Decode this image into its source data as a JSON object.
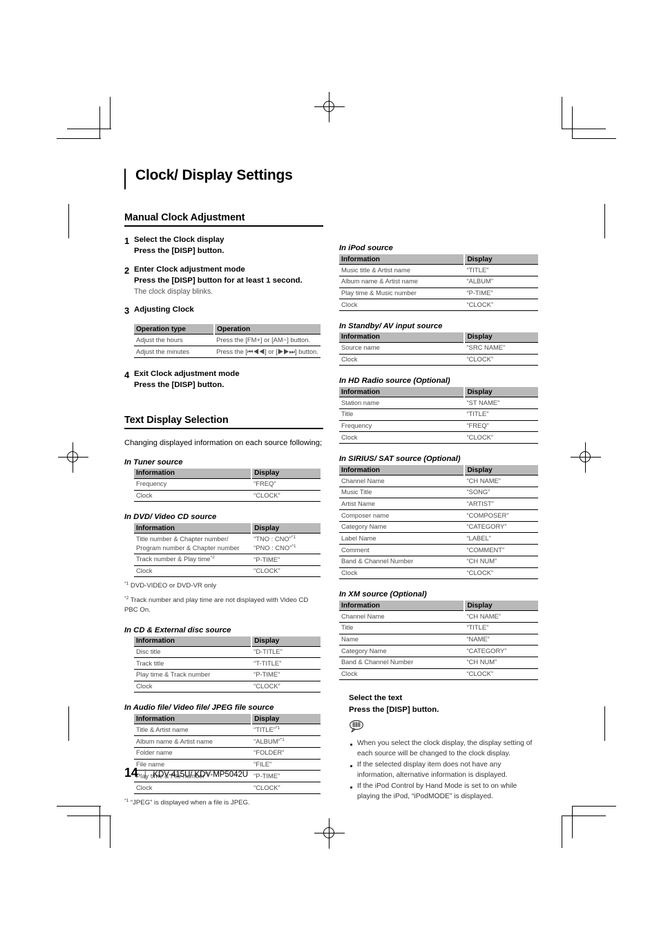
{
  "document": {
    "chapter_title": "Clock/ Display Settings",
    "footer": {
      "page_number": "14",
      "divider": "|",
      "model": "KDV-415U/ KDV-MP5042U"
    }
  },
  "manual_clock": {
    "heading": "Manual Clock Adjustment",
    "steps": [
      {
        "num": "1",
        "title": "Select the Clock display",
        "sub": "Press the [DISP] button.",
        "note": ""
      },
      {
        "num": "2",
        "title": "Enter Clock adjustment mode",
        "sub": "Press the [DISP] button for at least 1 second.",
        "note": "The clock display blinks."
      },
      {
        "num": "3",
        "title": "Adjusting Clock",
        "sub": "",
        "note": ""
      },
      {
        "num": "4",
        "title": "Exit Clock adjustment mode",
        "sub": "Press the [DISP] button.",
        "note": ""
      }
    ],
    "operation_table": {
      "headers": [
        "Operation type",
        "Operation"
      ],
      "rows": [
        [
          "Adjust the hours",
          "Press the [FM+] or [AM−] button."
        ],
        [
          "Adjust the minutes",
          "Press the [⏮◀◀] or [▶▶⏭] button."
        ]
      ]
    }
  },
  "text_display": {
    "heading": "Text Display Selection",
    "intro": "Changing displayed information on each source following;",
    "common_headers": [
      "Information",
      "Display"
    ],
    "tables": [
      {
        "caption": "In Tuner source",
        "rows": [
          [
            "Frequency",
            "“FREQ”"
          ],
          [
            "Clock",
            "“CLOCK”"
          ]
        ]
      },
      {
        "caption": "In DVD/ Video CD source",
        "rows": [
          [
            "Title number & Chapter number/",
            "“TNO : CNO”*1"
          ],
          [
            "Program number & Chapter number",
            "“PNO : CNO”*1"
          ],
          [
            "Track number & Play time*2",
            "“P-TIME”"
          ],
          [
            "Clock",
            "“CLOCK”"
          ]
        ],
        "footnotes": [
          "*1 DVD-VIDEO or DVD-VR only",
          "*2 Track number and play time are not displayed with Video CD PBC On."
        ]
      },
      {
        "caption": "In CD & External disc source",
        "rows": [
          [
            "Disc title",
            "“D-TITLE”"
          ],
          [
            "Track title",
            "“T-TITLE”"
          ],
          [
            "Play time & Track number",
            "“P-TIME”"
          ],
          [
            "Clock",
            "“CLOCK”"
          ]
        ]
      },
      {
        "caption": "In Audio file/ Video file/ JPEG file source",
        "rows": [
          [
            "Title & Artist name",
            "“TITLE”*1"
          ],
          [
            "Album name & Artist name",
            "“ALBUM”*1"
          ],
          [
            "Folder name",
            "“FOLDER”"
          ],
          [
            "File name",
            "“FILE”"
          ],
          [
            "Play time & File number*1",
            "“P-TIME”"
          ],
          [
            "Clock",
            "“CLOCK”"
          ]
        ],
        "footnotes": [
          "*1 “JPEG” is displayed when a file is JPEG."
        ]
      },
      {
        "caption": "In iPod source",
        "rows": [
          [
            "Music title & Artist name",
            "“TITLE”"
          ],
          [
            "Album name & Artist name",
            "“ALBUM”"
          ],
          [
            "Play time & Music number",
            "“P-TIME”"
          ],
          [
            "Clock",
            "“CLOCK”"
          ]
        ]
      },
      {
        "caption": "In Standby/ AV input source",
        "rows": [
          [
            "Source name",
            "“SRC NAME”"
          ],
          [
            "Clock",
            "“CLOCK”"
          ]
        ]
      },
      {
        "caption": "In HD Radio source (Optional)",
        "rows": [
          [
            "Station name",
            "“ST NAME”"
          ],
          [
            "Title",
            "“TITLE”"
          ],
          [
            "Frequency",
            "“FREQ”"
          ],
          [
            "Clock",
            "“CLOCK”"
          ]
        ]
      },
      {
        "caption": "In SIRIUS/ SAT source (Optional)",
        "rows": [
          [
            "Channel Name",
            "“CH NAME”"
          ],
          [
            "Music Title",
            "“SONG”"
          ],
          [
            "Artist Name",
            "“ARTIST”"
          ],
          [
            "Composer name",
            "“COMPOSER”"
          ],
          [
            "Category Name",
            "“CATEGORY”"
          ],
          [
            "Label Name",
            "“LABEL”"
          ],
          [
            "Comment",
            "“COMMENT”"
          ],
          [
            "Band & Channel Number",
            "“CH NUM”"
          ],
          [
            "Clock",
            "“CLOCK”"
          ]
        ]
      },
      {
        "caption": "In XM source (Optional)",
        "rows": [
          [
            "Channel Name",
            "“CH NAME”"
          ],
          [
            "Title",
            "“TITLE”"
          ],
          [
            "Name",
            "“NAME”"
          ],
          [
            "Category Name",
            "“CATEGORY”"
          ],
          [
            "Band & Channel Number",
            "“CH NUM”"
          ],
          [
            "Clock",
            "“CLOCK”"
          ]
        ]
      }
    ],
    "select_text": {
      "title": "Select the text",
      "sub": "Press the [DISP] button.",
      "notes": [
        "When you select the clock display, the display setting of each source will be changed to the clock display.",
        "If the selected display item does not have any information, alternative information is displayed.",
        "If the iPod Control by Hand Mode is set to on while playing the iPod, “iPodMODE” is displayed."
      ]
    }
  }
}
